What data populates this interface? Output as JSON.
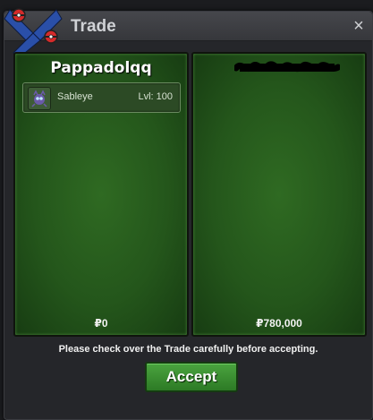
{
  "window": {
    "title": "Trade",
    "close_label": "×"
  },
  "left_panel": {
    "trainer_name": "Pappadolqq",
    "pokemon": [
      {
        "name": "Sableye",
        "level": "Lvl: 100"
      }
    ],
    "money": "₽0"
  },
  "right_panel": {
    "trainer_name": "",
    "pokemon": [],
    "money": "₽780,000"
  },
  "footer": {
    "notice": "Please check over the Trade carefully before accepting.",
    "accept_label": "Accept"
  },
  "colors": {
    "panel_green": "#24561b",
    "button_green": "#3b8f32",
    "window_bg": "#25262a"
  },
  "icons": {
    "logo": "pokeball-logo-icon",
    "pokemon": "sableye-icon",
    "close": "close-icon"
  }
}
